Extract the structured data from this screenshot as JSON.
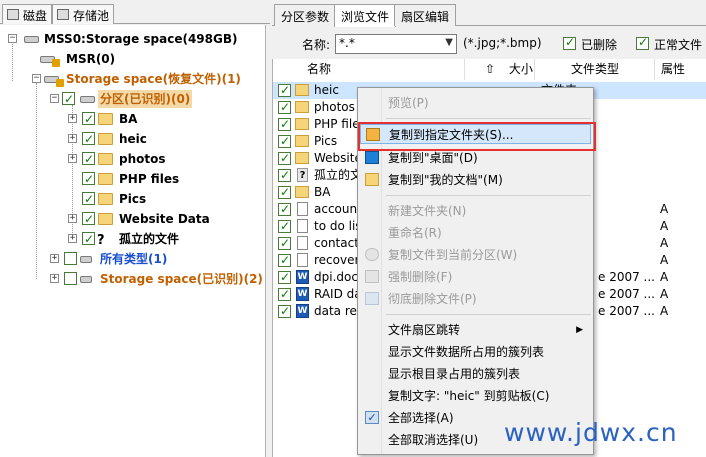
{
  "left_tabs": [
    "磁盘",
    "存储池"
  ],
  "tree": {
    "root": "MSS0:Storage space(498GB)",
    "msr": "MSR(0)",
    "storage_recovered": "Storage space(恢复文件)(1)",
    "partition": "分区(已识别)(0)",
    "folders": [
      "BA",
      "heic",
      "photos",
      "PHP files",
      "Pics",
      "Website Data",
      "孤立的文件"
    ],
    "all_types": "所有类型(1)",
    "storage_identified": "Storage space(已识别)(2)"
  },
  "right_tabs": [
    "分区参数",
    "浏览文件",
    "扇区编辑"
  ],
  "active_tab": "浏览文件",
  "toolbar": {
    "name_label": "名称:",
    "name_value": "*.*",
    "filter_hint": "(*.jpg;*.bmp)",
    "deleted_label": "已删除",
    "normal_label": "正常文件"
  },
  "columns": [
    "名称",
    "大小",
    "文件类型",
    "属性"
  ],
  "rows": [
    {
      "name": "heic",
      "type": "文件夹",
      "attr": "",
      "icon": "folder",
      "selected": true
    },
    {
      "name": "photos",
      "type": "",
      "attr": "",
      "icon": "folder"
    },
    {
      "name": "PHP files",
      "type": "",
      "attr": "",
      "icon": "folder"
    },
    {
      "name": "Pics",
      "type": "",
      "attr": "",
      "icon": "folder"
    },
    {
      "name": "Website Data",
      "type": "",
      "attr": "",
      "icon": "folder"
    },
    {
      "name": "孤立的文件",
      "type": "",
      "attr": "",
      "icon": "unknown"
    },
    {
      "name": "BA",
      "type": "",
      "attr": "",
      "icon": "folder"
    },
    {
      "name": "accounts",
      "type": "",
      "attr": "A",
      "icon": "doc"
    },
    {
      "name": "to do list",
      "type": "",
      "attr": "A",
      "icon": "doc"
    },
    {
      "name": "contacts",
      "type": "",
      "attr": "A",
      "icon": "doc"
    },
    {
      "name": "recovery",
      "type": "",
      "attr": "A",
      "icon": "doc"
    },
    {
      "name": "dpi.docx",
      "type": "e 2007 ...",
      "attr": "A",
      "icon": "word"
    },
    {
      "name": "RAID data",
      "type": "e 2007 ...",
      "attr": "A",
      "icon": "word"
    },
    {
      "name": "data report",
      "type": "e 2007 ...",
      "attr": "A",
      "icon": "word"
    }
  ],
  "context_menu": [
    {
      "label": "预览(P)",
      "disabled": true
    },
    {
      "sep": true
    },
    {
      "label": "复制到指定文件夹(S)...",
      "hot": true
    },
    {
      "label": "复制到\"桌面\"(D)"
    },
    {
      "label": "复制到\"我的文档\"(M)"
    },
    {
      "sep": true
    },
    {
      "label": "新建文件夹(N)",
      "disabled": true
    },
    {
      "label": "重命名(R)",
      "disabled": true
    },
    {
      "label": "复制文件到当前分区(W)",
      "disabled": true
    },
    {
      "label": "强制删除(F)",
      "disabled": true
    },
    {
      "label": "彻底删除文件(P)",
      "disabled": true
    },
    {
      "sep": true
    },
    {
      "label": "文件扇区跳转",
      "submenu": true
    },
    {
      "label": "显示文件数据所占用的簇列表"
    },
    {
      "label": "显示根目录占用的簇列表"
    },
    {
      "label": "复制文字: \"heic\" 到剪贴板(C)"
    },
    {
      "label": "全部选择(A)"
    },
    {
      "label": "全部取消选择(U)"
    }
  ],
  "watermark": "www.jdwx.cn",
  "colors": {
    "accent_red": "#e53030",
    "selection": "#cde5ff",
    "recovered_text": "#c06000",
    "type_link": "#1a4fd0"
  }
}
